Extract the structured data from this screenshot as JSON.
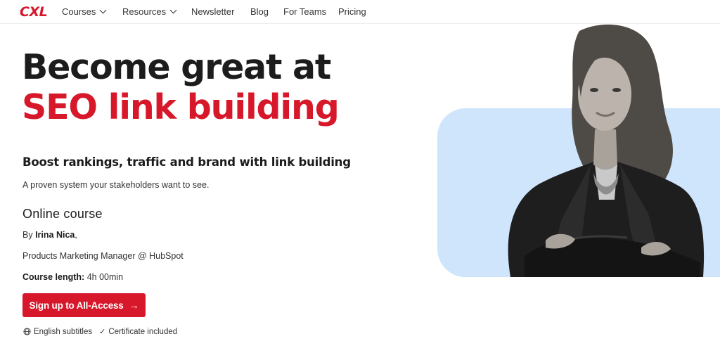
{
  "brand": {
    "logo_text": "CXL",
    "accent": "#d7182a"
  },
  "nav": {
    "items": [
      {
        "label": "Courses",
        "has_dropdown": true
      },
      {
        "label": "Resources",
        "has_dropdown": true
      },
      {
        "label": "Newsletter",
        "has_dropdown": false
      },
      {
        "label": "Blog",
        "has_dropdown": false
      },
      {
        "label": "For Teams",
        "has_dropdown": false
      },
      {
        "label": "Pricing",
        "has_dropdown": false
      }
    ]
  },
  "hero": {
    "title_line1": "Become great at",
    "title_line2": "SEO link building",
    "subheading": "Boost rankings, traffic and brand with link building",
    "tagline": "A proven system your stakeholders want to see.",
    "course_type": "Online course",
    "by_label": "By",
    "author": "Irina Nica",
    "author_suffix": ",",
    "author_title": "Products Marketing Manager @ HubSpot",
    "length_label": "Course length:",
    "length_value": "4h 00min",
    "cta_label": "Sign up to All-Access",
    "cta_arrow": "→",
    "badges": {
      "subtitles": "English subtitles",
      "certificate": "Certificate included"
    }
  },
  "visual": {
    "panel_color": "#cfe5fb"
  }
}
